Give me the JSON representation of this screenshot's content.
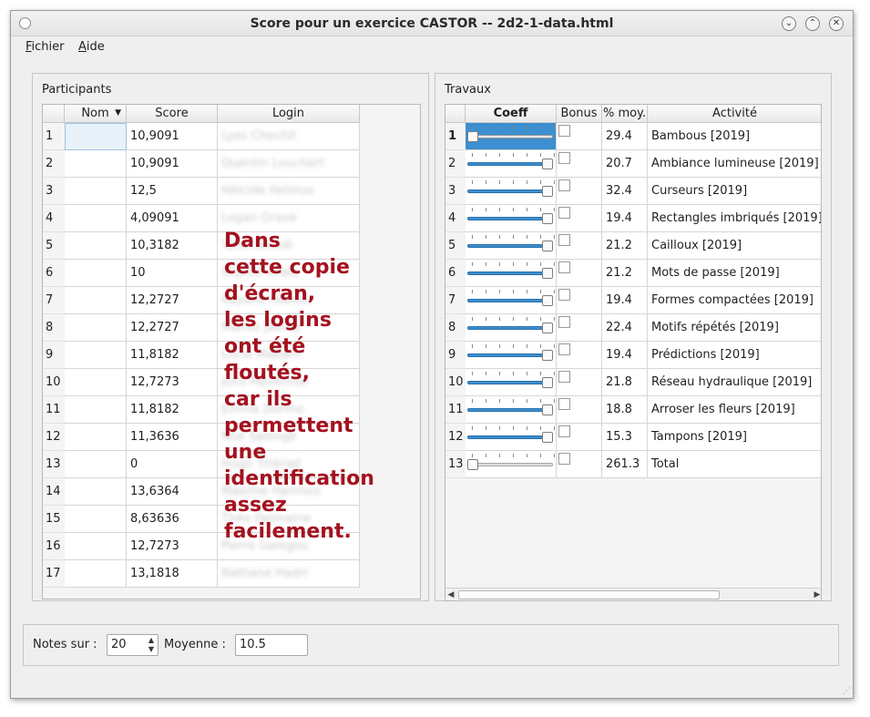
{
  "window": {
    "title": "Score pour un exercice CASTOR -- 2d2-1-data.html",
    "buttons": {
      "minimize": "⌄",
      "maximize": "⌃",
      "close": "✕"
    }
  },
  "menu": {
    "file": "Fichier",
    "file_mnemonic": "F",
    "file_rest": "ichier",
    "help_mnemonic": "A",
    "help_rest": "ide"
  },
  "participants": {
    "label": "Participants",
    "headers": {
      "name": "Nom",
      "score": "Score",
      "login": "Login"
    },
    "sort_icon": "sort-desc-icon",
    "rows": [
      {
        "n": "1",
        "score": "10,9091",
        "login": "Lyes Chechit"
      },
      {
        "n": "2",
        "score": "10,9091",
        "login": "Quentin Louchart"
      },
      {
        "n": "3",
        "score": "12,5",
        "login": "Hélcide Helmus"
      },
      {
        "n": "4",
        "score": "4,09091",
        "login": "Logan Grave"
      },
      {
        "n": "5",
        "score": "10,3182",
        "login": "Yanis Berkdi"
      },
      {
        "n": "6",
        "score": "10",
        "login": "Sophie Vhale"
      },
      {
        "n": "7",
        "score": "12,2727",
        "login": "Rayane Hdeour"
      },
      {
        "n": "8",
        "score": "12,2727",
        "login": "Mathis Jaomy"
      },
      {
        "n": "9",
        "score": "11,8182",
        "login": "Lucie Mabarh"
      },
      {
        "n": "10",
        "score": "12,7273",
        "login": "Joris Palvenroe"
      },
      {
        "n": "11",
        "score": "11,8182",
        "login": "Emma Dortho"
      },
      {
        "n": "12",
        "score": "11,3636",
        "login": "Noé Salonge"
      },
      {
        "n": "13",
        "score": "0",
        "login": "Hugo Tinkrad"
      },
      {
        "n": "14",
        "score": "13,6364",
        "login": "Maxime Harmois"
      },
      {
        "n": "15",
        "score": "8,63636",
        "login": "Théo Delmaine"
      },
      {
        "n": "16",
        "score": "12,7273",
        "login": "Pierre Galegou"
      },
      {
        "n": "17",
        "score": "13,1818",
        "login": "Nathane Hadrr"
      }
    ]
  },
  "overlay": {
    "lines": [
      "Dans",
      "cette copie",
      "d'écran,",
      "les logins",
      "ont été",
      "floutés,",
      "car ils",
      "permettent",
      "une",
      "identification",
      "assez",
      "facilement."
    ]
  },
  "travaux": {
    "label": "Travaux",
    "headers": {
      "coeff": "Coeff",
      "bonus": "Bonus",
      "pct": "% moy.",
      "activity": "Activité"
    },
    "rows": [
      {
        "n": "1",
        "pct": "29.4",
        "activity": "Bambous [2019]",
        "level": 0
      },
      {
        "n": "2",
        "pct": "20.7",
        "activity": "Ambiance lumineuse [2019]",
        "level": 1
      },
      {
        "n": "3",
        "pct": "32.4",
        "activity": "Curseurs [2019]",
        "level": 1
      },
      {
        "n": "4",
        "pct": "19.4",
        "activity": "Rectangles imbriqués [2019]",
        "level": 1
      },
      {
        "n": "5",
        "pct": "21.2",
        "activity": "Cailloux [2019]",
        "level": 1
      },
      {
        "n": "6",
        "pct": "21.2",
        "activity": "Mots de passe [2019]",
        "level": 1
      },
      {
        "n": "7",
        "pct": "19.4",
        "activity": "Formes compactées [2019]",
        "level": 1
      },
      {
        "n": "8",
        "pct": "22.4",
        "activity": "Motifs répétés [2019]",
        "level": 1
      },
      {
        "n": "9",
        "pct": "19.4",
        "activity": "Prédictions [2019]",
        "level": 1
      },
      {
        "n": "10",
        "pct": "21.8",
        "activity": "Réseau hydraulique [2019]",
        "level": 1
      },
      {
        "n": "11",
        "pct": "18.8",
        "activity": "Arroser les fleurs [2019]",
        "level": 1
      },
      {
        "n": "12",
        "pct": "15.3",
        "activity": "Tampons [2019]",
        "level": 1
      },
      {
        "n": "13",
        "pct": "261.3",
        "activity": "Total",
        "level": 0
      }
    ]
  },
  "footer": {
    "notes_label": "Notes sur :",
    "notes_value": "20",
    "moyenne_label": "Moyenne :",
    "moyenne_value": "10.5"
  },
  "colors": {
    "accent": "#3c8fd0",
    "overlay_text": "#a4121f"
  }
}
